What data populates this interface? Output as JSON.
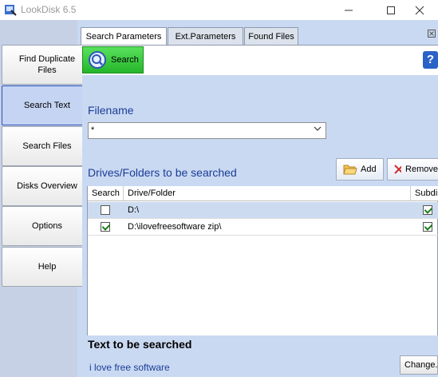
{
  "window": {
    "title": "LookDisk 6.5"
  },
  "nav": {
    "find_duplicate_line1": "Find Duplicate",
    "find_duplicate_line2": "Files",
    "search_text": "Search Text",
    "search_files": "Search Files",
    "disks_overview": "Disks Overview",
    "options": "Options",
    "help": "Help"
  },
  "tabs": {
    "search_parameters": "Search Parameters",
    "ext_parameters": "Ext.Parameters",
    "found_files": "Found Files"
  },
  "toolbar": {
    "search_label": "Search"
  },
  "filename": {
    "heading": "Filename",
    "value": "*"
  },
  "folders": {
    "heading": "Drives/Folders to be searched",
    "add_label": "Add",
    "remove_label": "Remove",
    "columns": {
      "search": "Search",
      "drive_folder": "Drive/Folder",
      "subdirs": "Subdir"
    },
    "rows": [
      {
        "checked": false,
        "path": "D:\\",
        "subdirs": true
      },
      {
        "checked": true,
        "path": "D:\\ilovefreesoftware zip\\",
        "subdirs": true
      }
    ]
  },
  "text_search": {
    "heading": "Text to be searched",
    "value": "i love free software",
    "change_label": "Change..."
  },
  "colors": {
    "accent": "#1a3d97",
    "nav_active": "#c4d4f2",
    "panel": "#cad9f2",
    "search_button": "#25b52a"
  }
}
